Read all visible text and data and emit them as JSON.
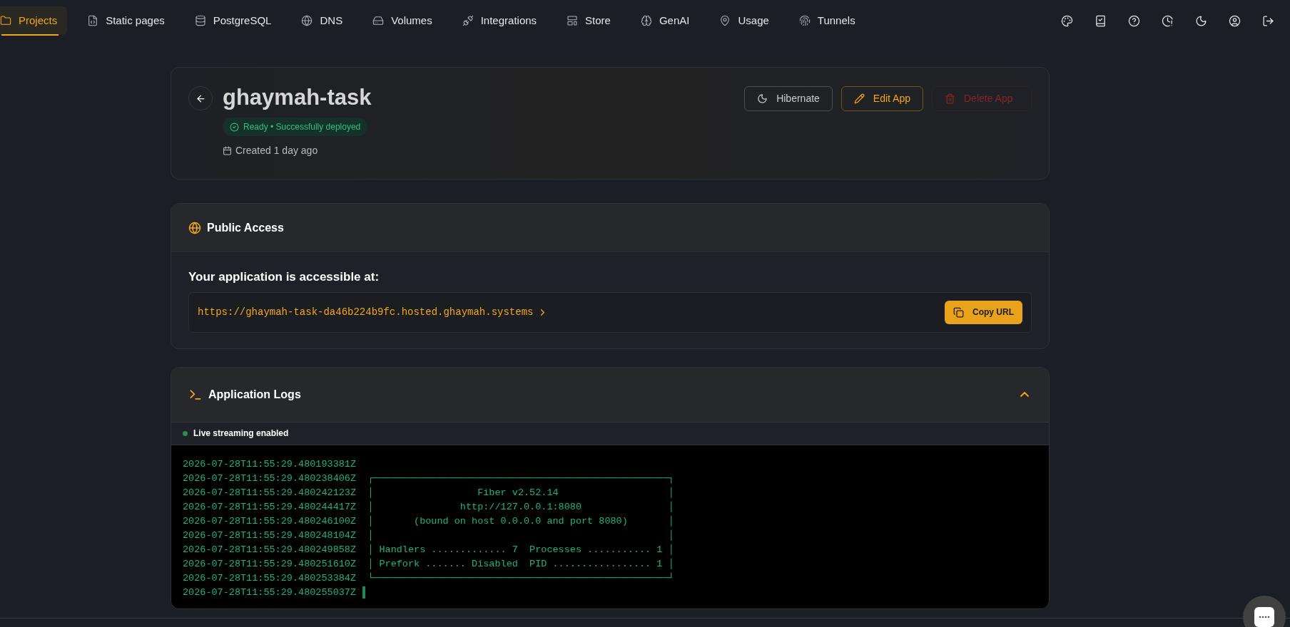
{
  "nav": {
    "items": [
      {
        "label": "Projects",
        "selected": true
      },
      {
        "label": "Static pages",
        "selected": false
      },
      {
        "label": "PostgreSQL",
        "selected": false
      },
      {
        "label": "DNS",
        "selected": false
      },
      {
        "label": "Volumes",
        "selected": false
      },
      {
        "label": "Integrations",
        "selected": false
      },
      {
        "label": "Store",
        "selected": false
      },
      {
        "label": "GenAI",
        "selected": false
      },
      {
        "label": "Usage",
        "selected": false
      },
      {
        "label": "Tunnels",
        "selected": false
      }
    ]
  },
  "app": {
    "title": "ghaymah-task",
    "status": "Ready • Successfully deployed",
    "created": "Created 1 day ago",
    "buttons": [
      {
        "label": "Hibernate",
        "kind": "neutral",
        "disabled": false
      },
      {
        "label": "Edit App",
        "kind": "edit",
        "disabled": false
      },
      {
        "label": "Delete App",
        "kind": "delete",
        "disabled": true
      }
    ]
  },
  "public_access": {
    "title": "Public Access",
    "heading": "Your application is accessible at:",
    "url": "https://ghaymah-task-da46b224b9fc.hosted.ghaymah.systems",
    "copy_button": "Copy URL"
  },
  "logs": {
    "title": "Application Logs",
    "expanded": true,
    "live": true,
    "live_label": "Live streaming enabled",
    "cursor": true,
    "lines": [
      "2026-07-28T11:55:29.480193381Z",
      "2026-07-28T11:55:29.480238406Z  ┌───────────────────────────────────────────────────┐",
      "2026-07-28T11:55:29.480242123Z  │                  Fiber v2.52.14                   │",
      "2026-07-28T11:55:29.480244417Z  │               http://127.0.0.1:8080               │",
      "2026-07-28T11:55:29.480246100Z  │       (bound on host 0.0.0.0 and port 8080)       │",
      "2026-07-28T11:55:29.480248104Z  │                                                   │",
      "2026-07-28T11:55:29.480249858Z  │ Handlers ............. 7  Processes ........... 1 │",
      "2026-07-28T11:55:29.480251610Z  │ Prefork ....... Disabled  PID ................. 1 │",
      "2026-07-28T11:55:29.480253384Z  └───────────────────────────────────────────────────┘",
      "2026-07-28T11:55:29.480255037Z"
    ]
  }
}
